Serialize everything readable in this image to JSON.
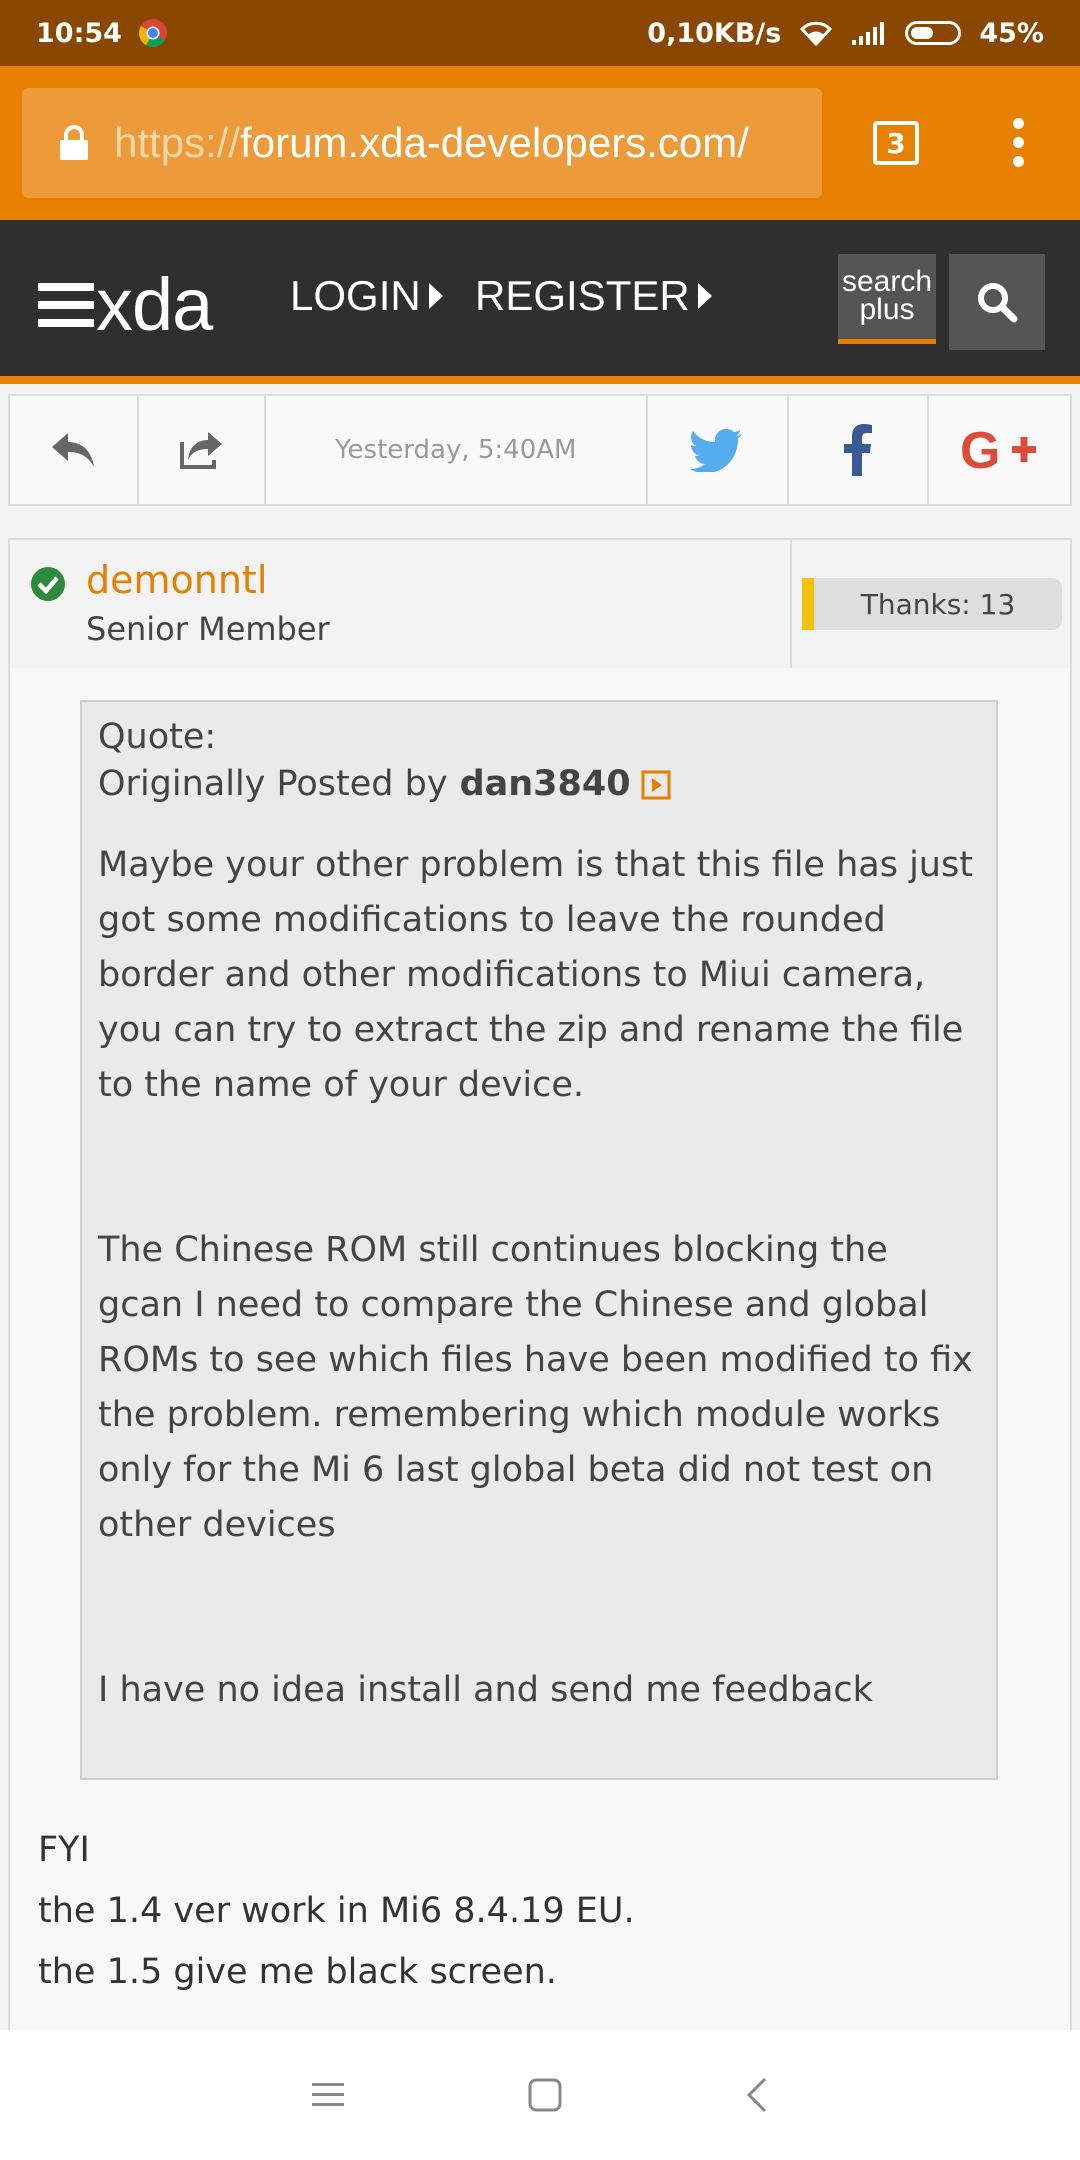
{
  "status_bar": {
    "time": "10:54",
    "network_speed": "0,10KB/s",
    "battery": "45%",
    "icons": [
      "chrome-icon",
      "wifi-icon",
      "signal-icon",
      "battery-icon"
    ]
  },
  "browser": {
    "url_scheme": "https://",
    "url_host": "forum.xda-developers.com/",
    "tab_count": "3"
  },
  "site_header": {
    "logo_text": "xda",
    "login_label": "LOGIN",
    "register_label": "REGISTER",
    "search_plus_line1": "search",
    "search_plus_line2": "plus"
  },
  "action_bar": {
    "post_date": "Yesterday, 5:40AM"
  },
  "post": {
    "username": "demonntl",
    "user_title": "Senior Member",
    "thanks": "Thanks: 13",
    "quote": {
      "heading": "Quote:",
      "originally_posted_by": "Originally Posted by",
      "author": "dan3840",
      "paragraphs": [
        "Maybe your other problem is that this file has just got some modifications to leave the rounded border and other modifications to Miui camera, you can try to extract the zip and rename the file to the name of your device.",
        "The Chinese ROM still continues blocking the gcan I need to compare the Chinese and global ROMs to see which files have been modified to fix the problem. remembering which module works only for the Mi 6 last global beta did not test on other devices",
        "I have no idea install and send me feedback"
      ]
    },
    "body_lines": [
      "FYI",
      "the 1.4 ver work in Mi6 8.4.19 EU.",
      "the 1.5 give me black screen."
    ]
  },
  "colors": {
    "accent": "#e77f00",
    "status_bar": "#8a4700",
    "header": "#2f2f2f",
    "online": "#2e8b3e",
    "twitter": "#55acee",
    "facebook": "#3b5998",
    "google_plus": "#dd4b39"
  }
}
